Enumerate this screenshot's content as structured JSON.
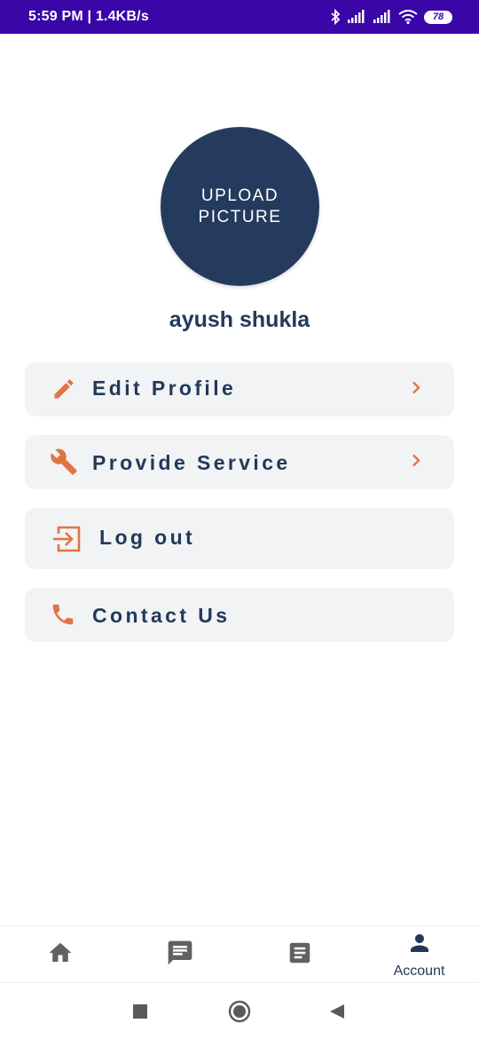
{
  "status_bar": {
    "time_speed": "5:59 PM | 1.4KB/s",
    "battery": "78",
    "icons": [
      "bluetooth-icon",
      "signal-icon",
      "signal-icon",
      "wifi-icon",
      "battery-icon"
    ]
  },
  "profile": {
    "upload_line1": "UPLOAD",
    "upload_line2": "PICTURE",
    "name": "ayush shukla"
  },
  "menu": {
    "items": [
      {
        "label": "Edit Profile",
        "icon": "pencil-icon",
        "chevron": true
      },
      {
        "label": "Provide Service",
        "icon": "wrench-icon",
        "chevron": true
      },
      {
        "label": "Log out",
        "icon": "logout-icon",
        "chevron": false
      },
      {
        "label": "Contact Us",
        "icon": "phone-icon",
        "chevron": false
      }
    ]
  },
  "bottom_nav": {
    "items": [
      {
        "icon": "home-icon",
        "label": ""
      },
      {
        "icon": "chat-icon",
        "label": ""
      },
      {
        "icon": "document-icon",
        "label": ""
      },
      {
        "icon": "person-icon",
        "label": "Account",
        "active": true
      }
    ]
  },
  "colors": {
    "status_bar": "#3a06a8",
    "primary_navy": "#243b5d",
    "text_navy": "#22395a",
    "accent_orange": "#e07442",
    "card_bg": "#f2f3f5",
    "nav_icon_gray": "#616161"
  }
}
